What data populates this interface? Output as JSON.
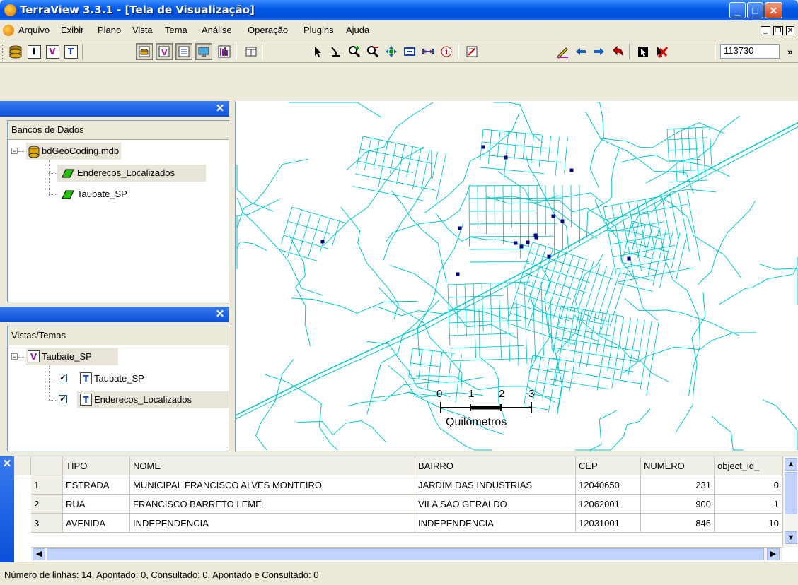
{
  "window": {
    "title": "TerraView 3.3.1 - [Tela de Visualização]"
  },
  "menu": [
    "Arquivo",
    "Exibir",
    "Plano",
    "Vista",
    "Tema",
    "Análise",
    "Operação",
    "Plugins",
    "Ajuda"
  ],
  "toolbar": {
    "scale_value": "113730",
    "overflow_label": "»"
  },
  "databases_panel": {
    "header": "Bancos de Dados",
    "db_name": "bdGeoCoding.mdb",
    "layers": [
      "Enderecos_Localizados",
      "Taubate_SP"
    ]
  },
  "views_panel": {
    "header": "Vistas/Temas",
    "view_name": "Taubate_SP",
    "themes": [
      {
        "name": "Taubate_SP",
        "checked": true
      },
      {
        "name": "Enderecos_Localizados",
        "checked": true
      }
    ]
  },
  "map": {
    "scale_ticks": [
      "0",
      "1",
      "2",
      "3"
    ],
    "scale_unit": "Quilômetros",
    "colors": {
      "streets": "#00c8cc",
      "points": "#000080"
    }
  },
  "grid": {
    "columns": [
      "TIPO",
      "NOME",
      "BAIRRO",
      "CEP",
      "NUMERO",
      "object_id_"
    ],
    "rows": [
      {
        "n": "1",
        "tipo": "ESTRADA",
        "nome": "MUNICIPAL FRANCISCO ALVES MONTEIRO",
        "bairro": "JARDIM DAS INDUSTRIAS",
        "cep": "12040650",
        "numero": "231",
        "object_id": "0"
      },
      {
        "n": "2",
        "tipo": "RUA",
        "nome": "FRANCISCO BARRETO LEME",
        "bairro": "VILA SAO GERALDO",
        "cep": "12062001",
        "numero": "900",
        "object_id": "1"
      },
      {
        "n": "3",
        "tipo": "AVENIDA",
        "nome": "INDEPENDENCIA",
        "bairro": "INDEPENDENCIA",
        "cep": "12031001",
        "numero": "846",
        "object_id": "10"
      }
    ]
  },
  "status": "Número de linhas: 14, Apontado: 0, Consultado: 0, Apontado e Consultado: 0"
}
